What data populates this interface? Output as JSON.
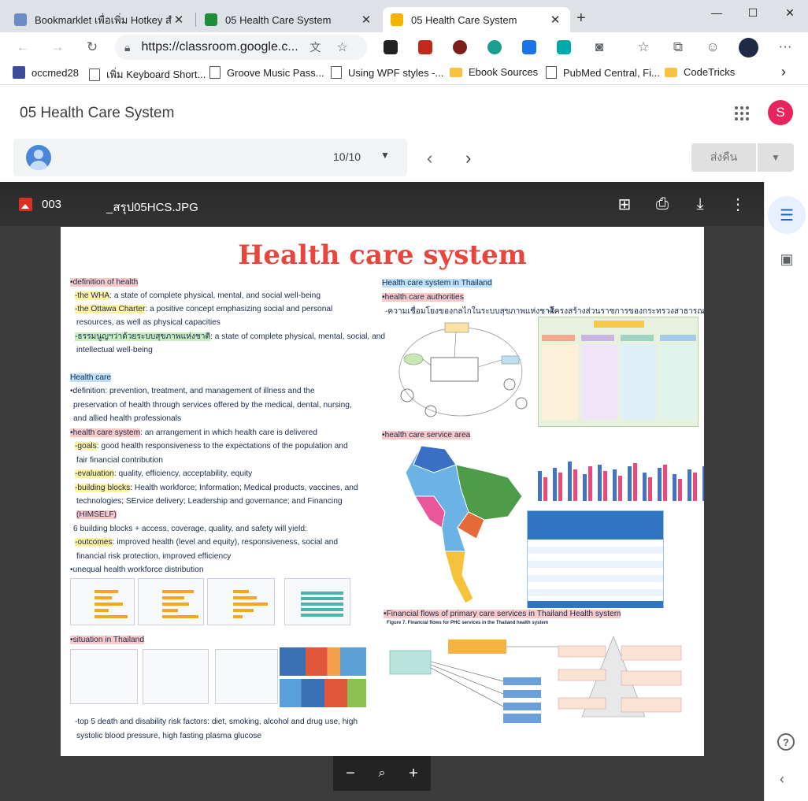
{
  "browser": {
    "tabs": [
      {
        "label": "Bookmarklet เพื่อเพิ่ม Hotkey สำหรั",
        "active": false
      },
      {
        "label": "05 Health Care System",
        "active": false
      },
      {
        "label": "05 Health Care System",
        "active": true
      }
    ],
    "new_tab": "+",
    "window": {
      "minimize": "—",
      "maximize": "☐",
      "close": "✕"
    },
    "url": "https://classroom.google.c...",
    "bookmarks": [
      {
        "label": "occmed28",
        "kind": "app"
      },
      {
        "label": "เพิ่ม Keyboard Short...",
        "kind": "page"
      },
      {
        "label": "Groove Music Pass...",
        "kind": "page"
      },
      {
        "label": "Using WPF styles -...",
        "kind": "page"
      },
      {
        "label": "Ebook Sources",
        "kind": "folder"
      },
      {
        "label": "PubMed Central, Fi...",
        "kind": "page"
      },
      {
        "label": "CodeTricks",
        "kind": "folder"
      }
    ],
    "bookmarks_more": "›"
  },
  "classroom": {
    "title": "05 Health Care System",
    "account_initial": "S",
    "student_counter": "10/10",
    "return_label": "ส่งคืน",
    "accent_color": "#e8245f"
  },
  "viewer": {
    "file_number": "003",
    "file_name": "_สรุป05HCS.JPG",
    "zoom_out": "−",
    "zoom_in": "+"
  },
  "poster": {
    "title": "Health care system",
    "left": {
      "l1": "•definition of health",
      "l2a": "-the WHA",
      "l2b": ": a state of complete physical, mental, and social well-being",
      "l3a": "-the Ottawa Charter",
      "l3b": ": a positive concept emphasizing social and personal",
      "l4": "resources, as well as physical capacities",
      "l5a": "-ธรรมนูญฯว่าด้วยระบบสุขภาพแห่งชาติ",
      "l5b": ": a state of complete physical, mental, social, and",
      "l6": "intellectual well-being",
      "l7": "Health care",
      "l8": "•definition: prevention, treatment, and management of illness and the",
      "l9": "preservation of health through services offered by the medical, dental, nursing,",
      "l10": "and allied health professionals",
      "l11a": "•health care system",
      "l11b": ": an arrangement in which health care is delivered",
      "l12a": "-goals",
      "l12b": ": good health responsiveness to the expectations of the population and",
      "l13": "fair financial contribution",
      "l14a": "-evaluation",
      "l14b": ": quality, efficiency, acceptability, equity",
      "l15a": "-building blocks",
      "l15b": ": Health workforce; Information; Medical products, vaccines, and",
      "l16": "technologies; SErvice delivery; Leadership and governance; and Financing",
      "l17": "(HIMSELF)",
      "l18": "6 building blocks + access, coverage, quality, and safety will yield:",
      "l19a": "-outcomes",
      "l19b": ": improved health (level and equity), responsiveness, social and",
      "l20": "financial risk protection, improved efficiency",
      "l21": "•unequal health workforce distribution",
      "l22": "•situation in Thailand",
      "l23": "-top 5 death and disability risk factors: diet, smoking, alcohol and drug use, high",
      "l24": "systolic blood pressure, high fasting plasma glucose"
    },
    "right": {
      "r1": "Health care system in Thailand",
      "r2": "•health care authorities",
      "r3": "-ความเชื่อมโยงของกลไกในระบบสุขภาพแห่งชาติ",
      "r4": "-โครงสร้างส่วนราชการของกระทรวงสาธารณสุข",
      "r5": "•health care service area",
      "r6": "•Financial flows of primary care services in Thailand Health system",
      "fig7": "Figure 7. Financial flows for PHC services in the Thailand health system"
    }
  }
}
